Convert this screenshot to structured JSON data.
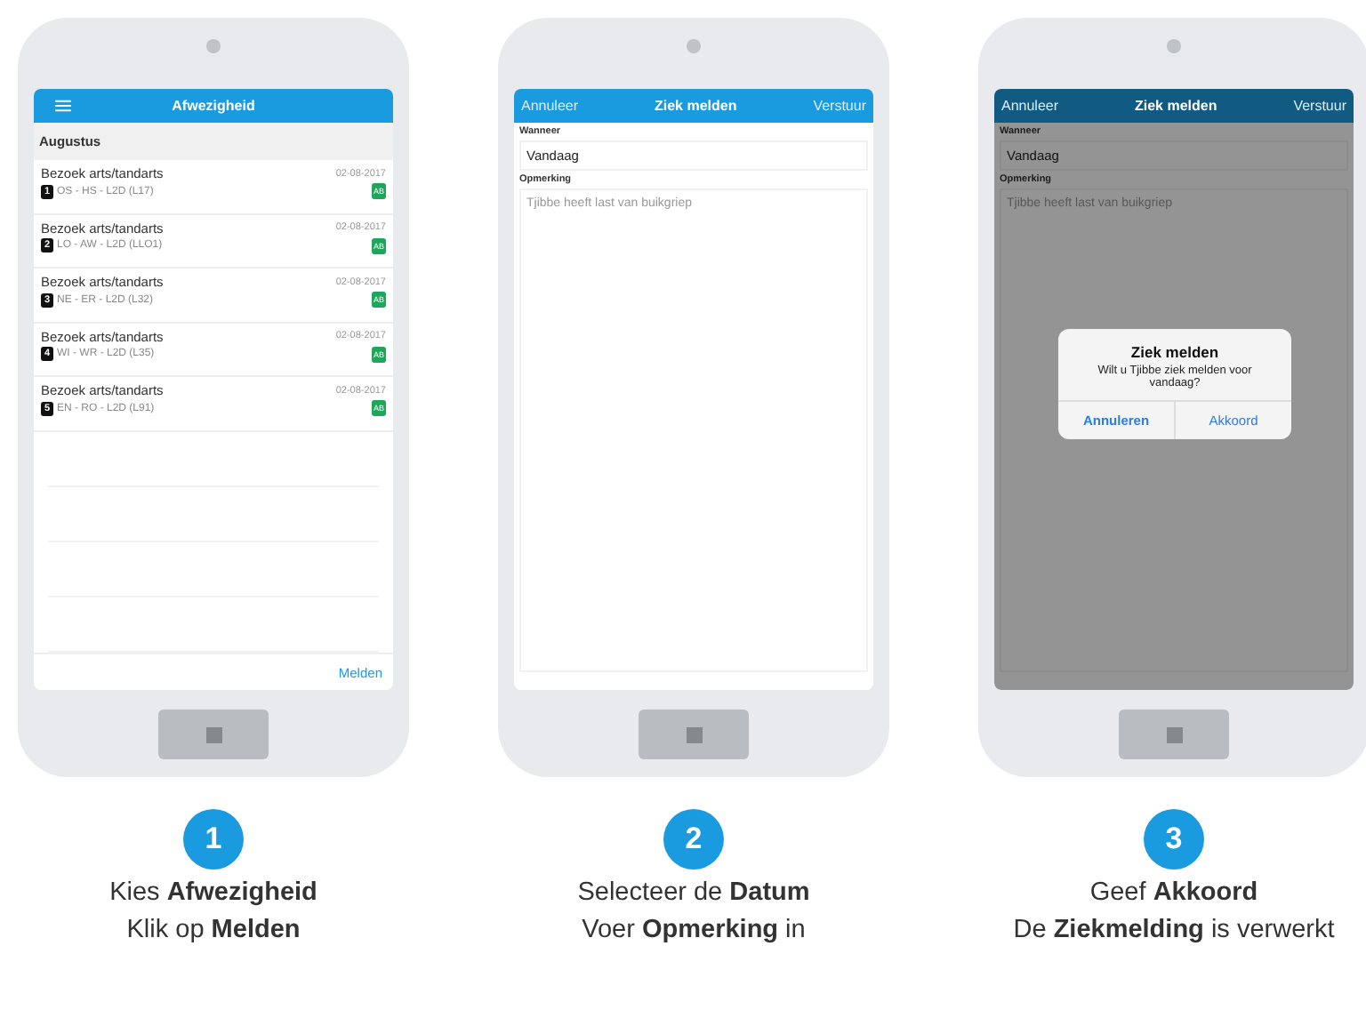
{
  "steps": [
    {
      "number": "1",
      "caption": [
        "Kies **Afwezigheid**",
        "Klik op  **Melden**"
      ],
      "screen": {
        "kind": "list",
        "nav": {
          "title": "Afwezigheid"
        },
        "section": "Augustus",
        "rows": [
          {
            "title": "Bezoek arts/tandarts",
            "date": "02-08-2017",
            "index": "1",
            "detail": "OS - HS - L2D (L17)",
            "badge": "AB"
          },
          {
            "title": "Bezoek arts/tandarts",
            "date": "02-08-2017",
            "index": "2",
            "detail": "LO - AW - L2D (LLO1)",
            "badge": "AB"
          },
          {
            "title": "Bezoek arts/tandarts",
            "date": "02-08-2017",
            "index": "3",
            "detail": "NE - ER - L2D (L32)",
            "badge": "AB"
          },
          {
            "title": "Bezoek arts/tandarts",
            "date": "02-08-2017",
            "index": "4",
            "detail": "WI - WR - L2D (L35)",
            "badge": "AB"
          },
          {
            "title": "Bezoek arts/tandarts",
            "date": "02-08-2017",
            "index": "5",
            "detail": "EN - RO - L2D (L91)",
            "badge": "AB"
          }
        ],
        "footer_action": "Melden"
      }
    },
    {
      "number": "2",
      "caption": [
        "Selecteer de **Datum**",
        "Voer **Opmerking** in"
      ],
      "screen": {
        "kind": "form",
        "nav": {
          "left": "Annuleer",
          "title": "Ziek melden",
          "right": "Verstuur"
        },
        "field": {
          "label": "Wanneer",
          "value": "Vandaag"
        },
        "remark": {
          "label": "Opmerking",
          "value": "Tjibbe heeft last van buikgriep"
        },
        "dimmed": false
      }
    },
    {
      "number": "3",
      "caption": [
        "Geef **Akkoord**",
        "De **Ziekmelding** is verwerkt"
      ],
      "screen": {
        "kind": "form",
        "nav": {
          "left": "Annuleer",
          "title": "Ziek melden",
          "right": "Verstuur"
        },
        "field": {
          "label": "Wanneer",
          "value": "Vandaag"
        },
        "remark": {
          "label": "Opmerking",
          "value": "Tjibbe heeft last van buikgriep"
        },
        "dimmed": true,
        "dialog": {
          "title": "Ziek melden",
          "message": "Wilt u Tjibbe ziek melden voor vandaag?",
          "buttons": [
            "Annuleren",
            "Akkoord"
          ]
        }
      }
    }
  ]
}
